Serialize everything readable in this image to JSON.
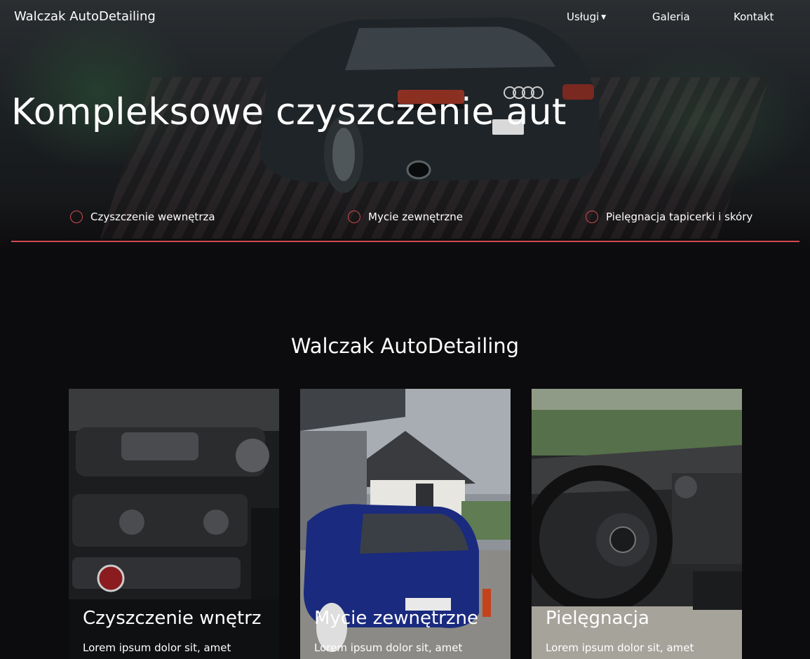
{
  "navbar": {
    "brand": "Walczak AutoDetailing",
    "items": [
      {
        "label": "Usługi",
        "dropdown": true
      },
      {
        "label": "Galeria",
        "dropdown": false
      },
      {
        "label": "Kontakt",
        "dropdown": false
      }
    ]
  },
  "hero": {
    "title": "Kompleksowe czyszczenie aut",
    "features": [
      {
        "label": "Czyszczenie wewnętrza",
        "icon": "circle-icon"
      },
      {
        "label": "Mycie zewnętrzne",
        "icon": "circle-icon"
      },
      {
        "label": "Pielęgnacja tapicerki i skóry",
        "icon": "circle-icon"
      }
    ]
  },
  "section": {
    "title": "Walczak AutoDetailing"
  },
  "cards": [
    {
      "title": "Czyszczenie wnętrz",
      "text": "Lorem ipsum dolor sit, amet"
    },
    {
      "title": "Mycie zewnętrzne",
      "text": "Lorem ipsum dolor sit, amet"
    },
    {
      "title": "Pielęgnacja",
      "text": "Lorem ipsum dolor sit, amet"
    }
  ],
  "colors": {
    "accent": "#d24a50",
    "background": "#0c0b0d",
    "text": "#ffffff"
  }
}
